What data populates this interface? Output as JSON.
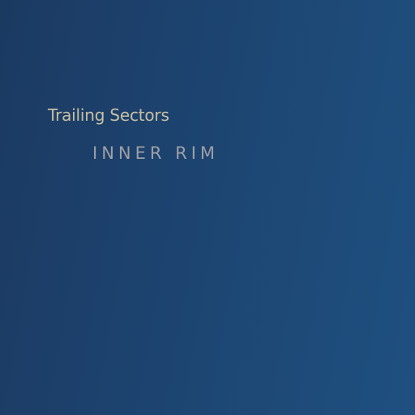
{
  "heading": "Trailing Sectors",
  "subheading": "INNER RIM",
  "colors": {
    "background_start": "#1b3a62",
    "background_end": "#1f5080",
    "heading": "#c7c0a3",
    "subheading": "#9e9fa6"
  }
}
